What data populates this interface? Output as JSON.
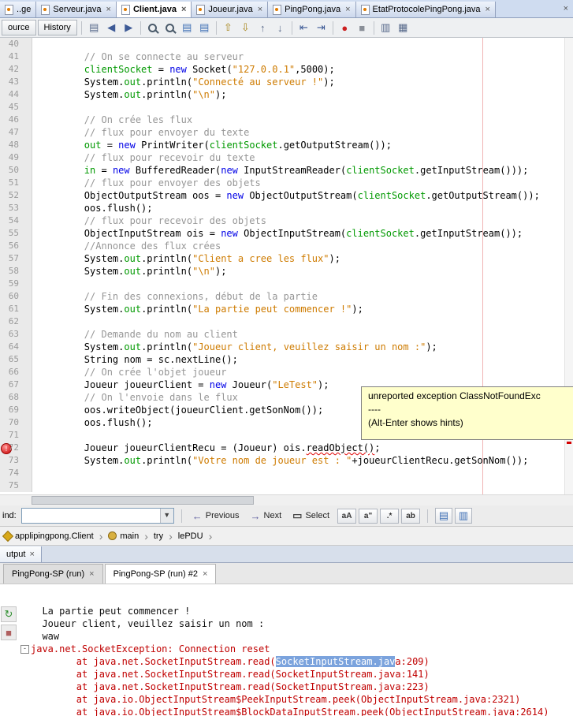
{
  "file_tabs": {
    "items": [
      {
        "label": "..ge",
        "active": false,
        "close": ""
      },
      {
        "label": "Serveur.java",
        "active": false,
        "close": "×"
      },
      {
        "label": "Client.java",
        "active": true,
        "close": "×"
      },
      {
        "label": "Joueur.java",
        "active": false,
        "close": "×"
      },
      {
        "label": "PingPong.java",
        "active": false,
        "close": "×"
      },
      {
        "label": "EtatProtocolePingPong.java",
        "active": false,
        "close": "×"
      }
    ],
    "trailing_close": "×"
  },
  "toolbar": {
    "source_label": "ource",
    "history_label": "History",
    "icons": [
      {
        "name": "last-edit-icon",
        "glyph": "▤",
        "color": "#56688a"
      },
      {
        "name": "back-icon",
        "glyph": "◀",
        "color": "#3d5a96"
      },
      {
        "name": "forward-icon",
        "glyph": "▶",
        "color": "#3d5a96",
        "sep_after": true
      },
      {
        "name": "find-selection-icon",
        "glyph": "MAG"
      },
      {
        "name": "find-next-occurrence-icon",
        "glyph": "MAG"
      },
      {
        "name": "copy-document-icon",
        "glyph": "▤",
        "color": "#3c6eb4"
      },
      {
        "name": "paste-document-icon",
        "glyph": "▤",
        "color": "#3c6eb4",
        "sep_after": true
      },
      {
        "name": "previous-bookmark-icon",
        "glyph": "⇧",
        "color": "#a8861c"
      },
      {
        "name": "next-bookmark-icon",
        "glyph": "⇩",
        "color": "#a8861c"
      },
      {
        "name": "previous-error-icon",
        "glyph": "↑",
        "color": "#5a6a8a"
      },
      {
        "name": "next-error-icon",
        "glyph": "↓",
        "color": "#5a6a8a",
        "sep_after": true
      },
      {
        "name": "shift-left-icon",
        "glyph": "⇤",
        "color": "#3d5a96"
      },
      {
        "name": "shift-right-icon",
        "glyph": "⇥",
        "color": "#3d5a96",
        "sep_after": true
      },
      {
        "name": "record-macro-icon",
        "glyph": "●",
        "color": "#cc2020"
      },
      {
        "name": "stop-macro-icon",
        "glyph": "■",
        "color": "#8a8f98",
        "sep_after": true
      },
      {
        "name": "comment-icon",
        "glyph": "▥",
        "color": "#56688a"
      },
      {
        "name": "uncomment-icon",
        "glyph": "▦",
        "color": "#56688a"
      }
    ]
  },
  "editor": {
    "margin_color": "#f0b4b4",
    "tooltip": {
      "line1": "unreported exception ClassNotFoundExc",
      "line2": "----",
      "line3": "(Alt-Enter shows hints)"
    },
    "lines": [
      {
        "n": 40,
        "t": []
      },
      {
        "n": 41,
        "t": [
          [
            "c",
            "        // On se connecte au serveur"
          ]
        ]
      },
      {
        "n": 42,
        "t": [
          [
            "p",
            "        "
          ],
          [
            "f",
            "clientSocket"
          ],
          [
            "p",
            " = "
          ],
          [
            "k",
            "new"
          ],
          [
            "p",
            " Socket("
          ],
          [
            "s",
            "\"127.0.0.1\""
          ],
          [
            "p",
            ",5000);"
          ]
        ]
      },
      {
        "n": 43,
        "t": [
          [
            "p",
            "        System."
          ],
          [
            "f",
            "out"
          ],
          [
            "p",
            ".println("
          ],
          [
            "s",
            "\"Connecté au serveur !\""
          ],
          [
            "p",
            ");"
          ]
        ]
      },
      {
        "n": 44,
        "t": [
          [
            "p",
            "        System."
          ],
          [
            "f",
            "out"
          ],
          [
            "p",
            ".println("
          ],
          [
            "s",
            "\"\\n\""
          ],
          [
            "p",
            ");"
          ]
        ]
      },
      {
        "n": 45,
        "t": []
      },
      {
        "n": 46,
        "t": [
          [
            "c",
            "        // On crée les flux"
          ]
        ]
      },
      {
        "n": 47,
        "t": [
          [
            "c",
            "        // flux pour envoyer du texte"
          ]
        ]
      },
      {
        "n": 48,
        "t": [
          [
            "p",
            "        "
          ],
          [
            "f",
            "out"
          ],
          [
            "p",
            " = "
          ],
          [
            "k",
            "new"
          ],
          [
            "p",
            " PrintWriter("
          ],
          [
            "f",
            "clientSocket"
          ],
          [
            "p",
            ".getOutputStream());"
          ]
        ]
      },
      {
        "n": 49,
        "t": [
          [
            "c",
            "        // flux pour recevoir du texte"
          ]
        ]
      },
      {
        "n": 50,
        "t": [
          [
            "p",
            "        "
          ],
          [
            "f",
            "in"
          ],
          [
            "p",
            " = "
          ],
          [
            "k",
            "new"
          ],
          [
            "p",
            " BufferedReader("
          ],
          [
            "k",
            "new"
          ],
          [
            "p",
            " InputStreamReader("
          ],
          [
            "f",
            "clientSocket"
          ],
          [
            "p",
            ".getInputStream()));"
          ]
        ]
      },
      {
        "n": 51,
        "t": [
          [
            "c",
            "        // flux pour envoyer des objets"
          ]
        ]
      },
      {
        "n": 52,
        "t": [
          [
            "p",
            "        ObjectOutputStream oos = "
          ],
          [
            "k",
            "new"
          ],
          [
            "p",
            " ObjectOutputStream("
          ],
          [
            "f",
            "clientSocket"
          ],
          [
            "p",
            ".getOutputStream());"
          ]
        ]
      },
      {
        "n": 53,
        "t": [
          [
            "p",
            "        oos.flush();"
          ]
        ]
      },
      {
        "n": 54,
        "t": [
          [
            "c",
            "        // flux pour recevoir des objets"
          ]
        ]
      },
      {
        "n": 55,
        "t": [
          [
            "p",
            "        ObjectInputStream ois = "
          ],
          [
            "k",
            "new"
          ],
          [
            "p",
            " ObjectInputStream("
          ],
          [
            "f",
            "clientSocket"
          ],
          [
            "p",
            ".getInputStream());"
          ]
        ]
      },
      {
        "n": 56,
        "t": [
          [
            "c",
            "        //Annonce des flux crées"
          ]
        ]
      },
      {
        "n": 57,
        "t": [
          [
            "p",
            "        System."
          ],
          [
            "f",
            "out"
          ],
          [
            "p",
            ".println("
          ],
          [
            "s",
            "\"Client a cree les flux\""
          ],
          [
            "p",
            ");"
          ]
        ]
      },
      {
        "n": 58,
        "t": [
          [
            "p",
            "        System."
          ],
          [
            "f",
            "out"
          ],
          [
            "p",
            ".println("
          ],
          [
            "s",
            "\"\\n\""
          ],
          [
            "p",
            ");"
          ]
        ]
      },
      {
        "n": 59,
        "t": []
      },
      {
        "n": 60,
        "t": [
          [
            "c",
            "        // Fin des connexions, début de la partie"
          ]
        ]
      },
      {
        "n": 61,
        "t": [
          [
            "p",
            "        System."
          ],
          [
            "f",
            "out"
          ],
          [
            "p",
            ".println("
          ],
          [
            "s",
            "\"La partie peut commencer !\""
          ],
          [
            "p",
            ");"
          ]
        ]
      },
      {
        "n": 62,
        "t": []
      },
      {
        "n": 63,
        "t": [
          [
            "c",
            "        // Demande du nom au client"
          ]
        ]
      },
      {
        "n": 64,
        "t": [
          [
            "p",
            "        System."
          ],
          [
            "f",
            "out"
          ],
          [
            "p",
            ".println("
          ],
          [
            "s",
            "\"Joueur client, veuillez saisir un nom :\""
          ],
          [
            "p",
            ");"
          ]
        ]
      },
      {
        "n": 65,
        "t": [
          [
            "p",
            "        String nom = sc.nextLine();"
          ]
        ]
      },
      {
        "n": 66,
        "t": [
          [
            "c",
            "        // On crée l'objet joueur"
          ]
        ]
      },
      {
        "n": 67,
        "t": [
          [
            "p",
            "        Joueur joueurClient = "
          ],
          [
            "k",
            "new"
          ],
          [
            "p",
            " Joueur("
          ],
          [
            "s",
            "\"LeTest\""
          ],
          [
            "p",
            ");"
          ]
        ]
      },
      {
        "n": 68,
        "t": [
          [
            "c",
            "        // On l'envoie dans le flux"
          ]
        ]
      },
      {
        "n": 69,
        "t": [
          [
            "p",
            "        oos.writeObject(joueurClient.getSonNom());"
          ]
        ]
      },
      {
        "n": 70,
        "t": [
          [
            "p",
            "        oos.flush();"
          ]
        ]
      },
      {
        "n": 71,
        "t": []
      },
      {
        "n": 72,
        "m": "error",
        "t": [
          [
            "p",
            "        Joueur joueurClientRecu = (Joueur) ois."
          ],
          [
            "e",
            "readObject()"
          ],
          [
            "p",
            ";"
          ]
        ]
      },
      {
        "n": 73,
        "t": [
          [
            "p",
            "        System."
          ],
          [
            "f",
            "out"
          ],
          [
            "p",
            ".println("
          ],
          [
            "s",
            "\"Votre nom de joueur est : \""
          ],
          [
            "p",
            "+joueurClientRecu.getSonNom());"
          ]
        ]
      },
      {
        "n": 74,
        "t": []
      },
      {
        "n": 75,
        "t": []
      }
    ]
  },
  "find_bar": {
    "label": "ind:",
    "query": "",
    "previous_label": "Previous",
    "next_label": "Next",
    "select_label": "Select",
    "previous_arrow": "←",
    "next_arrow": "→",
    "select_glyph": "▭",
    "toggles": [
      {
        "name": "match-case-toggle",
        "glyph": "aA"
      },
      {
        "name": "whole-words-toggle",
        "glyph": "a\""
      },
      {
        "name": "regex-toggle",
        "glyph": ".*"
      },
      {
        "name": "highlight-results-toggle",
        "glyph": "ab"
      }
    ],
    "doc_icons": [
      {
        "name": "search-history-icon",
        "glyph": "▤"
      },
      {
        "name": "search-in-selection-icon",
        "glyph": "▥"
      }
    ]
  },
  "breadcrumb": {
    "items": [
      {
        "label": "applipingpong.Client",
        "icon": "class-icon"
      },
      {
        "label": "main",
        "icon": "method-icon"
      },
      {
        "label": "try",
        "icon": ""
      },
      {
        "label": "lePDU",
        "icon": ""
      }
    ],
    "chevron": "›"
  },
  "output": {
    "window_tab": {
      "label": "utput",
      "close": "×"
    },
    "tabs": [
      {
        "label": "PingPong-SP (run)",
        "close": "×",
        "active": false
      },
      {
        "label": "PingPong-SP (run) #2",
        "close": "×",
        "active": true
      }
    ],
    "toolbar": [
      {
        "name": "rerun-icon",
        "glyph": "↻",
        "color": "#2f8f2f"
      },
      {
        "name": "stop-icon",
        "glyph": "■",
        "color": "#b06060"
      }
    ],
    "fold_glyph": "-",
    "lines": [
      {
        "t": [
          [
            "o",
            "  La partie peut commencer !"
          ]
        ]
      },
      {
        "t": [
          [
            "o",
            "  Joueur client, veuillez saisir un nom :"
          ]
        ]
      },
      {
        "t": [
          [
            "o",
            "  waw"
          ]
        ]
      },
      {
        "fold": true,
        "t": [
          [
            "e",
            "java.net.SocketException: Connection reset"
          ]
        ]
      },
      {
        "t": [
          [
            "e",
            "        at java.net.SocketInputStream.read("
          ],
          [
            "sel",
            "SocketInputStream.jav"
          ],
          [
            "e",
            "a:209)"
          ]
        ]
      },
      {
        "t": [
          [
            "e",
            "        at java.net.SocketInputStream.read(SocketInputStream.java:141)"
          ]
        ]
      },
      {
        "t": [
          [
            "e",
            "        at java.net.SocketInputStream.read(SocketInputStream.java:223)"
          ]
        ]
      },
      {
        "t": [
          [
            "e",
            "        at java.io.ObjectInputStream$PeekInputStream.peek(ObjectInputStream.java:2321)"
          ]
        ]
      },
      {
        "t": [
          [
            "e",
            "        at java.io.ObjectInputStream$BlockDataInputStream.peek(ObjectInputStream.java:2614)"
          ]
        ]
      }
    ]
  }
}
